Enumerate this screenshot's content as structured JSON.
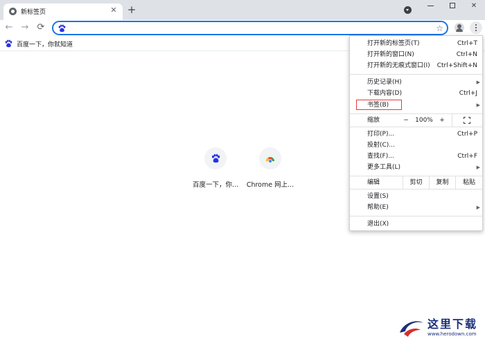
{
  "tab": {
    "title": "新标签页",
    "close_glyph": "✕"
  },
  "newtab_glyph": "+",
  "window": {
    "close_glyph": "✕"
  },
  "nav": {
    "back_glyph": "←",
    "forward_glyph": "→",
    "reload_glyph": "⟳"
  },
  "omnibox": {
    "value": "",
    "star_glyph": "☆"
  },
  "bookmarks_bar": [
    {
      "label": "百度一下，你就知道",
      "icon": "baidu-paw-icon"
    }
  ],
  "shortcuts": [
    {
      "label": "百度一下，你...",
      "icon": "baidu-paw-icon"
    },
    {
      "label": "Chrome 网上...",
      "icon": "chrome-webstore-icon"
    }
  ],
  "menu": {
    "group1": [
      {
        "label": "打开新的标签页(T)",
        "shortcut": "Ctrl+T"
      },
      {
        "label": "打开新的窗口(N)",
        "shortcut": "Ctrl+N"
      },
      {
        "label": "打开新的无痕式窗口(I)",
        "shortcut": "Ctrl+Shift+N"
      }
    ],
    "group2": [
      {
        "label": "历史记录(H)",
        "shortcut": "",
        "submenu": true
      },
      {
        "label": "下载内容(D)",
        "shortcut": "Ctrl+J",
        "submenu": false
      },
      {
        "label": "书签(B)",
        "shortcut": "",
        "submenu": true,
        "highlighted": true
      }
    ],
    "zoom": {
      "label": "缩放",
      "minus": "−",
      "level": "100%",
      "plus": "+"
    },
    "group3": [
      {
        "label": "打印(P)...",
        "shortcut": "Ctrl+P",
        "submenu": false
      },
      {
        "label": "投射(C)...",
        "shortcut": "",
        "submenu": false
      },
      {
        "label": "查找(F)...",
        "shortcut": "Ctrl+F",
        "submenu": false
      },
      {
        "label": "更多工具(L)",
        "shortcut": "",
        "submenu": true
      }
    ],
    "edit": {
      "label": "编辑",
      "cut": "剪切",
      "copy": "复制",
      "paste": "粘贴"
    },
    "group4": [
      {
        "label": "设置(S)",
        "submenu": false
      },
      {
        "label": "帮助(E)",
        "submenu": true
      }
    ],
    "exit": {
      "label": "退出(X)"
    },
    "submenu_arrow": "▶"
  },
  "watermark": {
    "text": "这里下载",
    "url": "www.herodown.com"
  },
  "colors": {
    "accent": "#1a73e8",
    "highlight_box": "#e53935",
    "baidu_blue": "#2932e1"
  }
}
